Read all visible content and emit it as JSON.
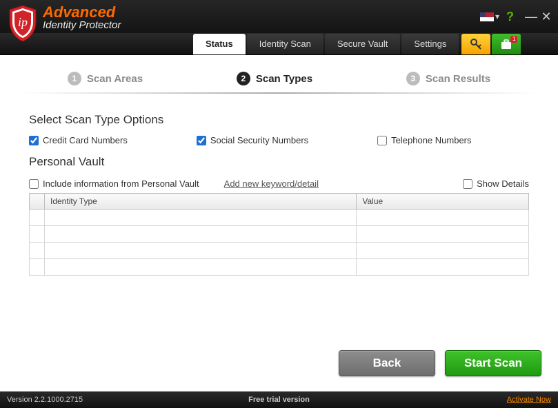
{
  "brand": {
    "title": "Advanced",
    "subtitle": "Identity Protector"
  },
  "titlebar": {
    "help_tooltip": "Help",
    "minimize": "—",
    "close": "✕"
  },
  "tabs": {
    "status": "Status",
    "identity_scan": "Identity Scan",
    "secure_vault": "Secure Vault",
    "settings": "Settings"
  },
  "iconbuttons": {
    "cart_badge": "1"
  },
  "steps": {
    "s1": {
      "num": "1",
      "label": "Scan Areas"
    },
    "s2": {
      "num": "2",
      "label": "Scan Types"
    },
    "s3": {
      "num": "3",
      "label": "Scan Results"
    }
  },
  "headings": {
    "scan_type_options": "Select Scan Type Options",
    "personal_vault": "Personal Vault"
  },
  "options": {
    "credit_card": "Credit Card Numbers",
    "ssn": "Social Security Numbers",
    "telephone": "Telephone Numbers",
    "include_vault": "Include information from Personal Vault",
    "show_details": "Show Details"
  },
  "links": {
    "add_keyword": "Add new keyword/detail"
  },
  "table": {
    "col_identity": "Identity Type",
    "col_value": "Value"
  },
  "buttons": {
    "back": "Back",
    "start": "Start Scan"
  },
  "status": {
    "version_label": "Version 2.2.1000.2715",
    "trial": "Free trial version",
    "activate": "Activate Now"
  }
}
